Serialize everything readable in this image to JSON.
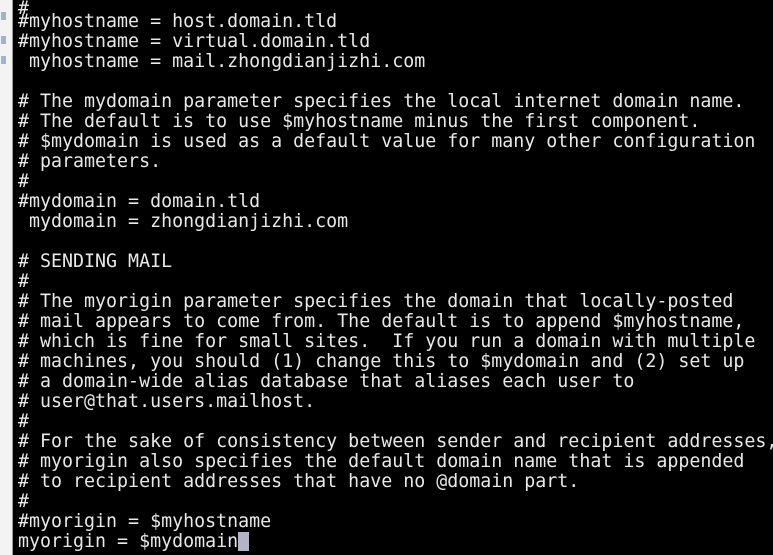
{
  "terminal": {
    "lines": [
      "#",
      "#myhostname = host.domain.tld",
      "#myhostname = virtual.domain.tld",
      " myhostname = mail.zhongdianjizhi.com",
      "",
      "# The mydomain parameter specifies the local internet domain name.",
      "# The default is to use $myhostname minus the first component.",
      "# $mydomain is used as a default value for many other configuration",
      "# parameters.",
      "#",
      "#mydomain = domain.tld",
      " mydomain = zhongdianjizhi.com",
      "",
      "# SENDING MAIL",
      "#",
      "# The myorigin parameter specifies the domain that locally-posted",
      "# mail appears to come from. The default is to append $myhostname,",
      "# which is fine for small sites.  If you run a domain with multiple",
      "# machines, you should (1) change this to $mydomain and (2) set up",
      "# a domain-wide alias database that aliases each user to",
      "# user@that.users.mailhost.",
      "#",
      "# For the sake of consistency between sender and recipient addresses,",
      "# myorigin also specifies the default domain name that is appended",
      "# to recipient addresses that have no @domain part.",
      "#",
      "#myorigin = $myhostname",
      "myorigin = $mydomain"
    ]
  }
}
